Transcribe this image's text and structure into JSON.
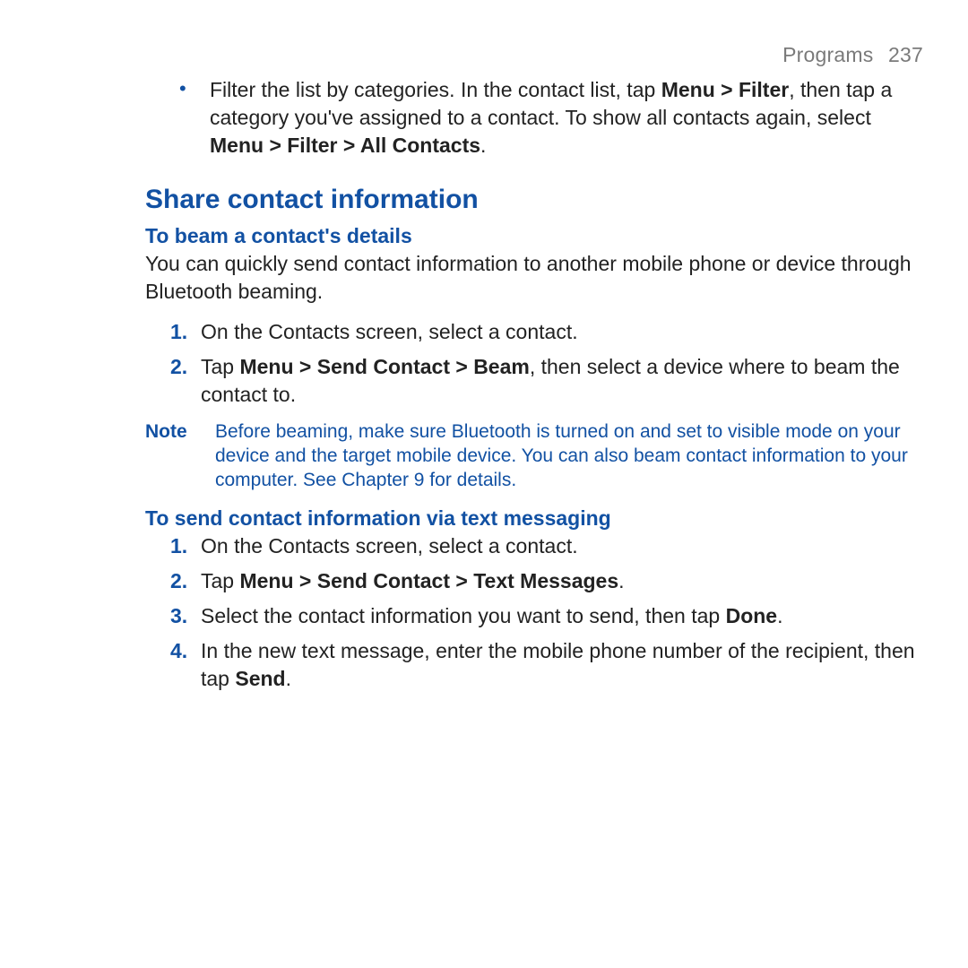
{
  "header": {
    "section": "Programs",
    "page": "237"
  },
  "intro_bullet": {
    "pre": "Filter the list by categories. In the contact list, tap ",
    "bold1": "Menu > Filter",
    "mid": ", then tap a category you've assigned to a contact. To show all contacts again, select ",
    "bold2": "Menu > Filter > All Contacts",
    "post": "."
  },
  "section_title": "Share contact information",
  "beam": {
    "subtitle": "To beam a contact's details",
    "intro": "You can quickly send contact information to another mobile phone or device through Bluetooth beaming.",
    "steps": [
      {
        "num": "1.",
        "pre": "On the Contacts screen, select a contact.",
        "bold": "",
        "post": ""
      },
      {
        "num": "2.",
        "pre": "Tap ",
        "bold": "Menu > Send Contact > Beam",
        "post": ", then select a device where to beam the contact to."
      }
    ]
  },
  "note": {
    "label": "Note",
    "text": "Before beaming, make sure Bluetooth is turned on and set to visible mode on your device and the target mobile device. You can also beam contact information to your computer. See Chapter 9 for details."
  },
  "sms": {
    "subtitle": "To send contact information via text messaging",
    "steps": [
      {
        "num": "1.",
        "pre": "On the Contacts screen, select a contact.",
        "bold": "",
        "post": ""
      },
      {
        "num": "2.",
        "pre": "Tap ",
        "bold": "Menu > Send Contact > Text Messages",
        "post": "."
      },
      {
        "num": "3.",
        "pre": "Select the contact information you want to send, then tap ",
        "bold": "Done",
        "post": "."
      },
      {
        "num": "4.",
        "pre": "In the new text message, enter the mobile phone number of the recipient, then tap ",
        "bold": "Send",
        "post": "."
      }
    ]
  }
}
